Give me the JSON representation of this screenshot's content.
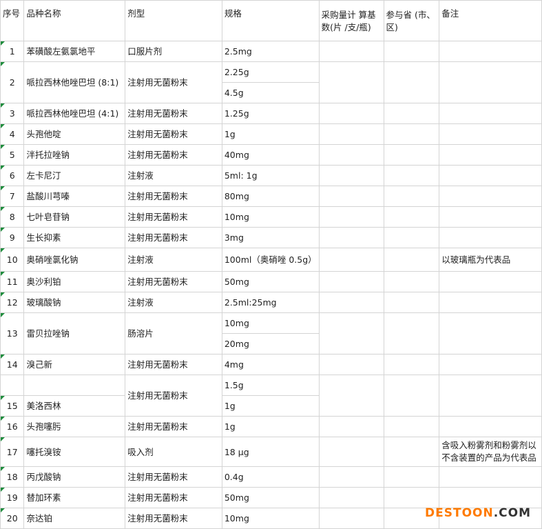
{
  "header": {
    "no": "序号",
    "name": "品种名称",
    "form": "剂型",
    "spec": "规格",
    "qty": "采购量计 算基数(片 /支/瓶)",
    "prov": "参与省 (市、区)",
    "note": "备注"
  },
  "rows": [
    {
      "no": "1",
      "name": "苯磺酸左氨氯地平",
      "form": "口服片剂",
      "spec": "2.5mg",
      "note": ""
    },
    {
      "no": "2",
      "name": "哌拉西林他唑巴坦 (8:1)",
      "form": "注射用无菌粉末",
      "spec": "2.25g",
      "spec2": "4.5g",
      "note": ""
    },
    {
      "no": "3",
      "name": "哌拉西林他唑巴坦 (4:1)",
      "form": "注射用无菌粉末",
      "spec": "1.25g",
      "note": ""
    },
    {
      "no": "4",
      "name": "头孢他啶",
      "form": "注射用无菌粉末",
      "spec": "1g",
      "note": ""
    },
    {
      "no": "5",
      "name": "泮托拉唑钠",
      "form": "注射用无菌粉末",
      "spec": "40mg",
      "note": ""
    },
    {
      "no": "6",
      "name": "左卡尼汀",
      "form": "注射液",
      "spec": "5ml: 1g",
      "note": ""
    },
    {
      "no": "7",
      "name": "盐酸川芎嗪",
      "form": "注射用无菌粉末",
      "spec": "80mg",
      "note": ""
    },
    {
      "no": "8",
      "name": "七叶皂苷钠",
      "form": "注射用无菌粉末",
      "spec": "10mg",
      "note": ""
    },
    {
      "no": "9",
      "name": "生长抑素",
      "form": "注射用无菌粉末",
      "spec": "3mg",
      "note": ""
    },
    {
      "no": "10",
      "name": "奥硝唑氯化钠",
      "form": "注射液",
      "spec": "100ml（奥硝唑 0.5g）",
      "note": "以玻璃瓶为代表品"
    },
    {
      "no": "11",
      "name": "奥沙利铂",
      "form": "注射用无菌粉末",
      "spec": "50mg",
      "note": ""
    },
    {
      "no": "12",
      "name": "玻璃酸钠",
      "form": "注射液",
      "spec": "2.5ml:25mg",
      "note": ""
    },
    {
      "no": "13",
      "name": "雷贝拉唑钠",
      "form": "肠溶片",
      "spec": "10mg",
      "spec2": "20mg",
      "note": ""
    },
    {
      "no": "14",
      "name": "溴己新",
      "form": "注射用无菌粉末",
      "spec": "4mg",
      "note": ""
    },
    {
      "no": "15",
      "name": "美洛西林",
      "form": "注射用无菌粉末",
      "spec": "1.5g",
      "spec2": "1g",
      "note": ""
    },
    {
      "no": "16",
      "name": "头孢噻肟",
      "form": "注射用无菌粉末",
      "spec": "1g",
      "note": ""
    },
    {
      "no": "17",
      "name": "噻托溴铵",
      "form": "吸入剂",
      "spec": "18 μg",
      "note": "含吸入粉雾剂和粉雾剂以不含装置的产品为代表品"
    },
    {
      "no": "18",
      "name": "丙戊酸钠",
      "form": "注射用无菌粉末",
      "spec": "0.4g",
      "note": ""
    },
    {
      "no": "19",
      "name": "替加环素",
      "form": "注射用无菌粉末",
      "spec": "50mg",
      "note": ""
    },
    {
      "no": "20",
      "name": "奈达铂",
      "form": "注射用无菌粉末",
      "spec": "10mg",
      "note": ""
    }
  ],
  "watermark": {
    "part1": "DESTOON",
    "part2": ".COM"
  }
}
